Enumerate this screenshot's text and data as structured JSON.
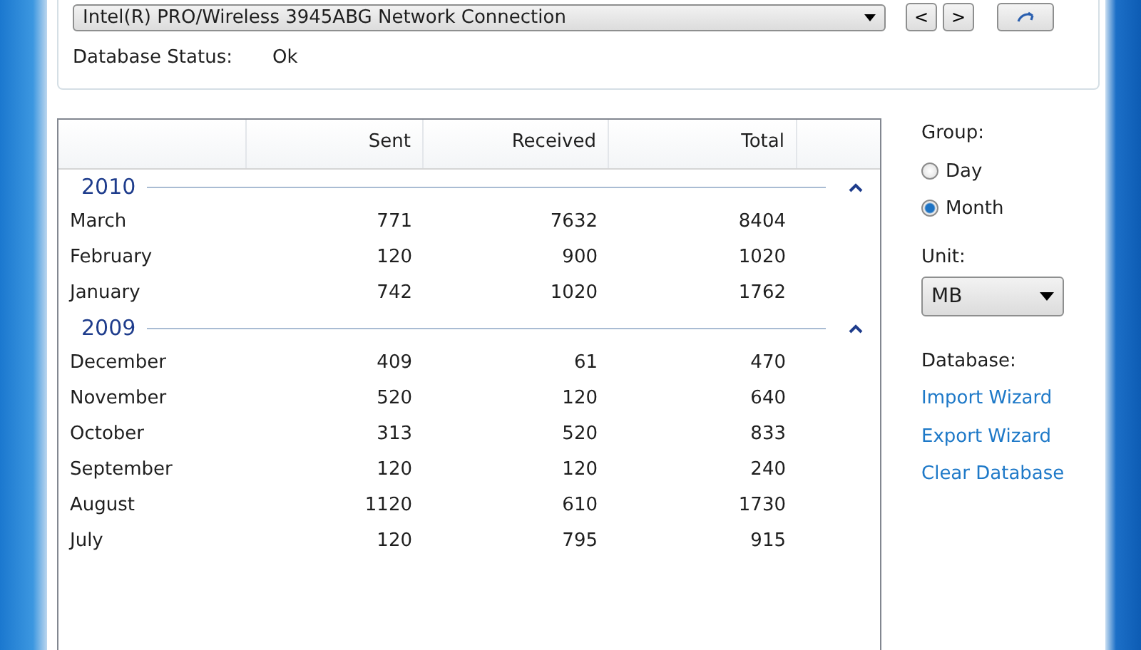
{
  "adapter": {
    "value": "Intel(R) PRO/Wireless 3945ABG Network Connection",
    "prev": "<",
    "next": ">"
  },
  "database_status": {
    "label": "Database Status:",
    "value": "Ok"
  },
  "table": {
    "columns": [
      "",
      "Sent",
      "Received",
      "Total"
    ],
    "groups": [
      {
        "title": "2010",
        "expanded": true,
        "rows": [
          [
            "March",
            "771",
            "7632",
            "8404"
          ],
          [
            "February",
            "120",
            "900",
            "1020"
          ],
          [
            "January",
            "742",
            "1020",
            "1762"
          ]
        ]
      },
      {
        "title": "2009",
        "expanded": true,
        "rows": [
          [
            "December",
            "409",
            "61",
            "470"
          ],
          [
            "November",
            "520",
            "120",
            "640"
          ],
          [
            "October",
            "313",
            "520",
            "833"
          ],
          [
            "September",
            "120",
            "120",
            "240"
          ],
          [
            "August",
            "1120",
            "610",
            "1730"
          ],
          [
            "July",
            "120",
            "795",
            "915"
          ]
        ]
      }
    ]
  },
  "group": {
    "label": "Group:",
    "options": [
      {
        "label": "Day",
        "selected": false
      },
      {
        "label": "Month",
        "selected": true
      }
    ]
  },
  "unit": {
    "label": "Unit:",
    "value": "MB"
  },
  "database": {
    "label": "Database:",
    "links": [
      "Import Wizard",
      "Export Wizard",
      "Clear Database"
    ]
  }
}
